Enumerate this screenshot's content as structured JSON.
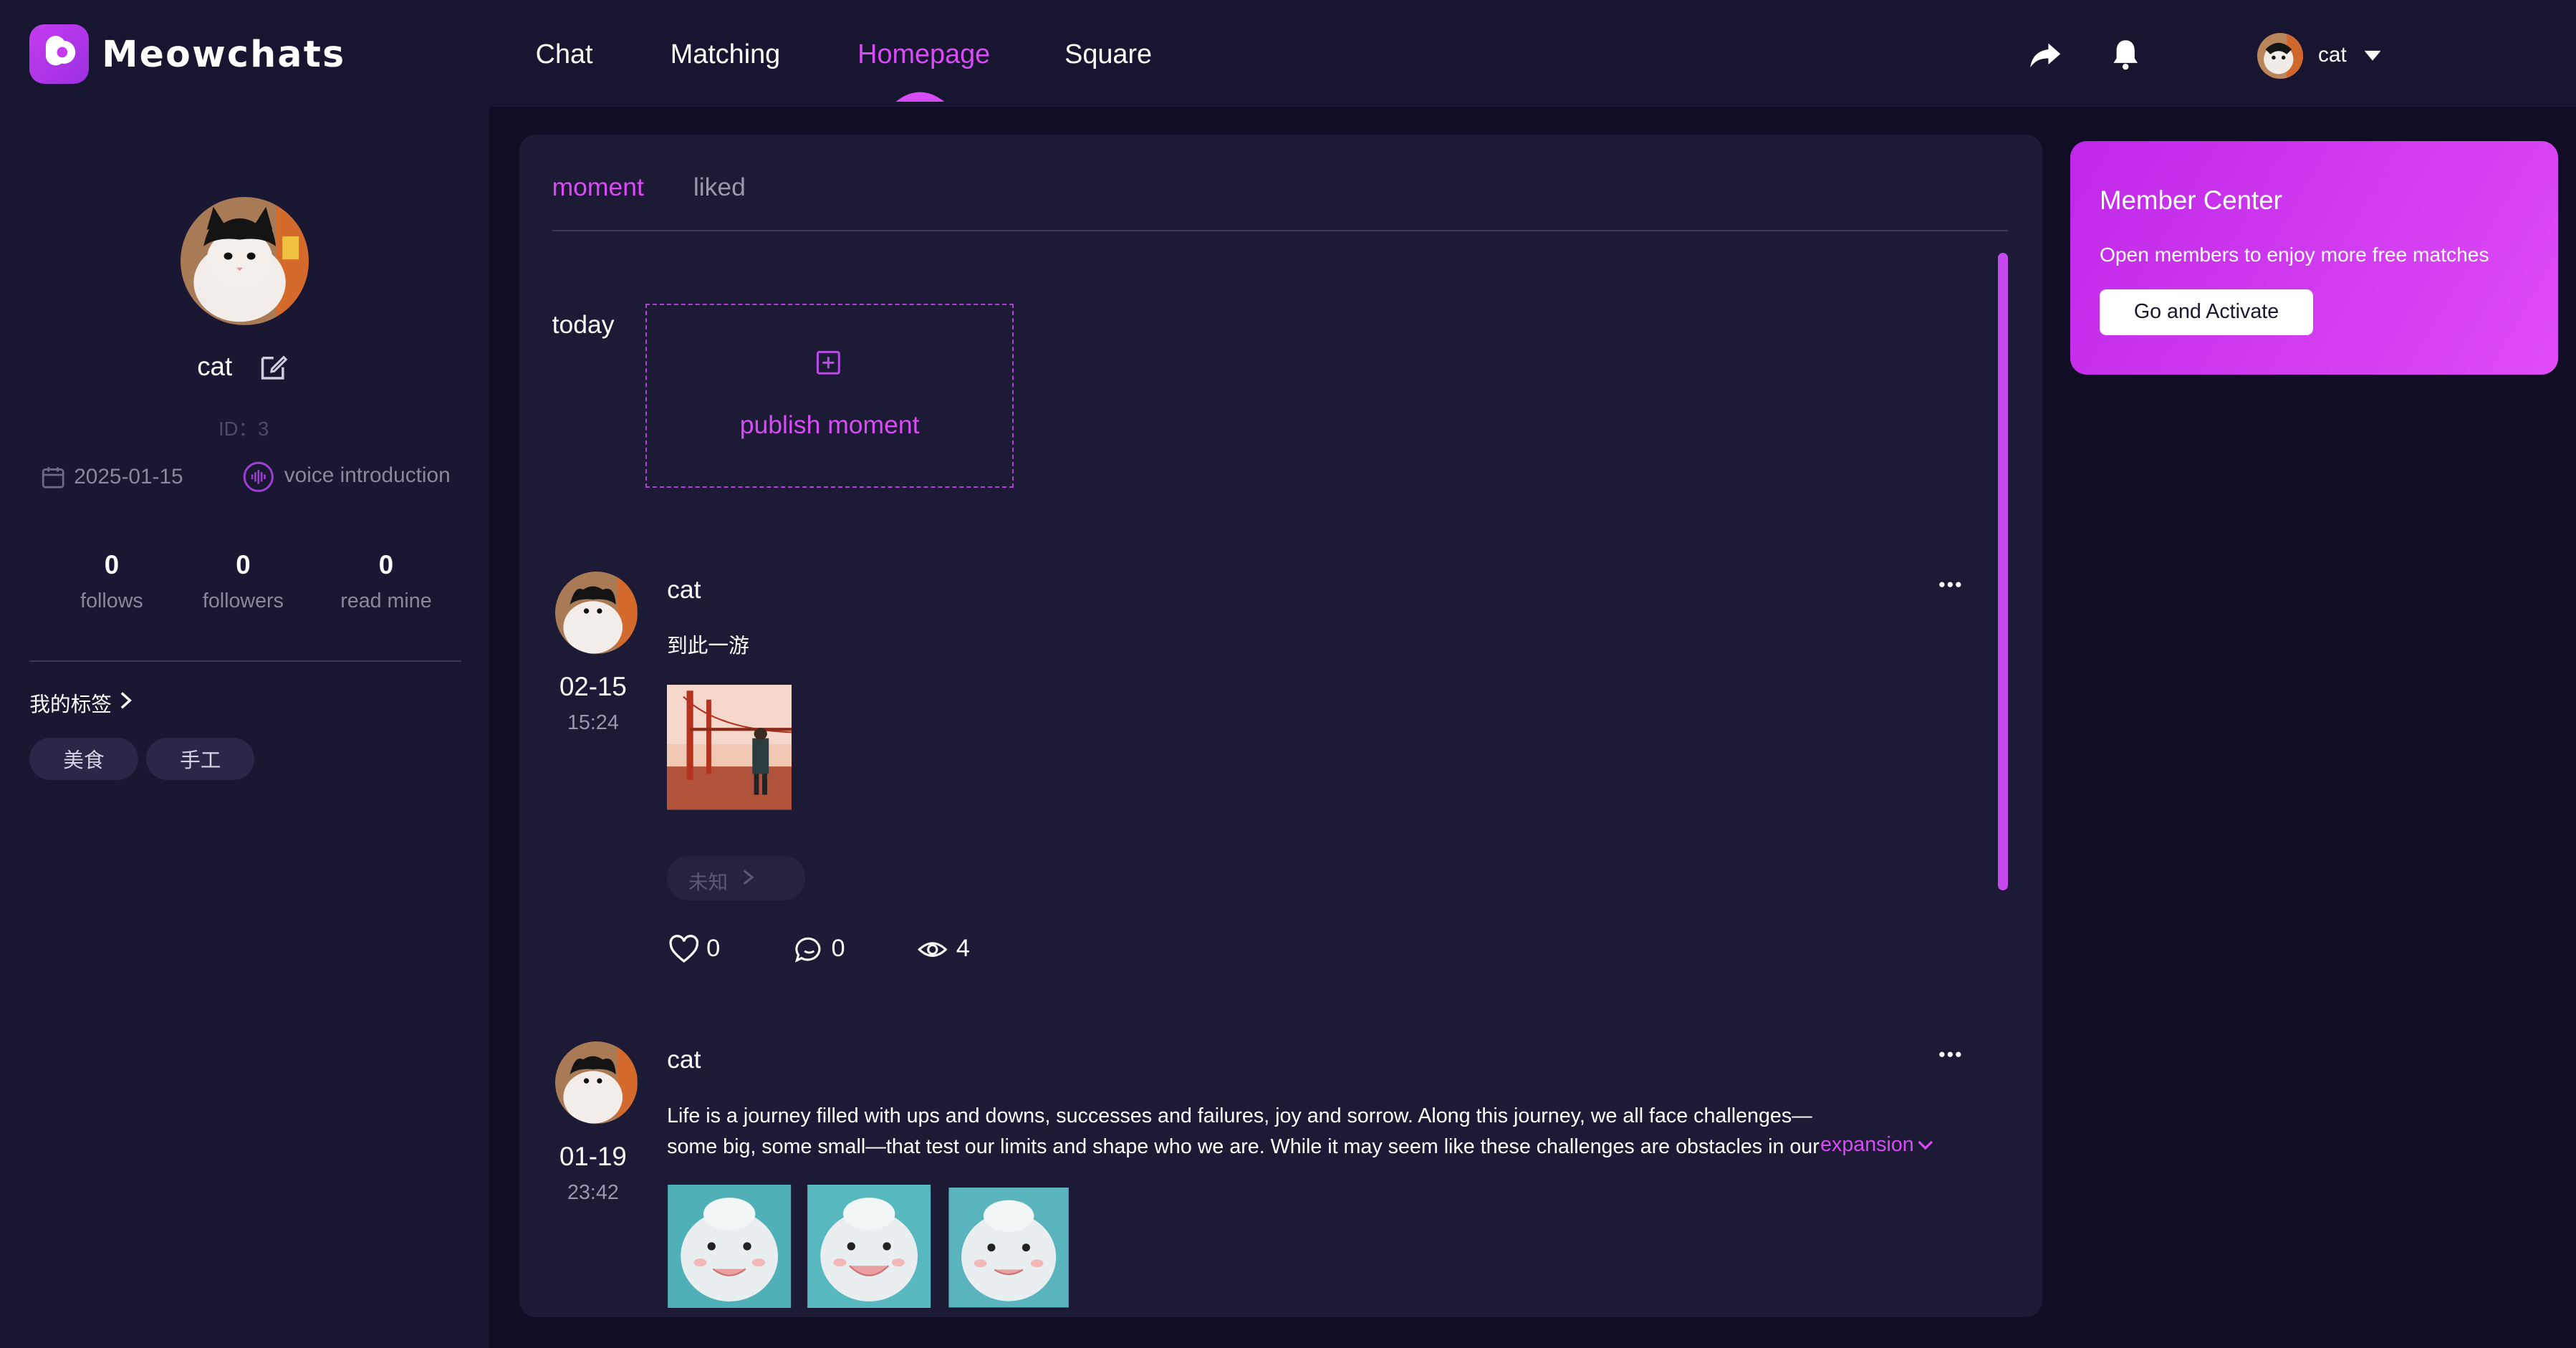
{
  "header": {
    "app_name": "Meowchats",
    "nav": [
      "Chat",
      "Matching",
      "Homepage",
      "Square"
    ],
    "active_nav": "Homepage",
    "username": "cat"
  },
  "profile": {
    "name": "cat",
    "id_text": "ID：3",
    "join_date": "2025-01-15",
    "voice_intro": "voice introduction",
    "stats": [
      {
        "value": "0",
        "label": "follows"
      },
      {
        "value": "0",
        "label": "followers"
      },
      {
        "value": "0",
        "label": "read mine"
      }
    ],
    "tags_title": "我的标签",
    "tags": [
      "美食",
      "手工"
    ]
  },
  "main": {
    "tabs": [
      "moment",
      "liked"
    ],
    "active_tab": "moment",
    "today_label": "today",
    "publish_label": "publish moment",
    "posts": [
      {
        "author": "cat",
        "date": "02-15",
        "time": "15:24",
        "text": "到此一游",
        "location": "未知",
        "likes": "0",
        "comments": "0",
        "views": "4"
      },
      {
        "author": "cat",
        "date": "01-19",
        "time": "23:42",
        "text_line1": "Life is a journey filled with ups and downs, successes and failures, joy and sorrow. Along this journey, we all face challenges—",
        "text_line2": "some big, some small—that test our limits and shape who we are. While it may seem like these challenges are obstacles in our",
        "expand_label": "expansion"
      }
    ]
  },
  "member": {
    "title": "Member Center",
    "subtitle": "Open members to enjoy more free matches",
    "button_label": "Go and Activate"
  },
  "colors": {
    "accent": "#d84cf5",
    "background": "#110d24",
    "panel": "#1d1a36",
    "sidebar": "#1a1733"
  }
}
